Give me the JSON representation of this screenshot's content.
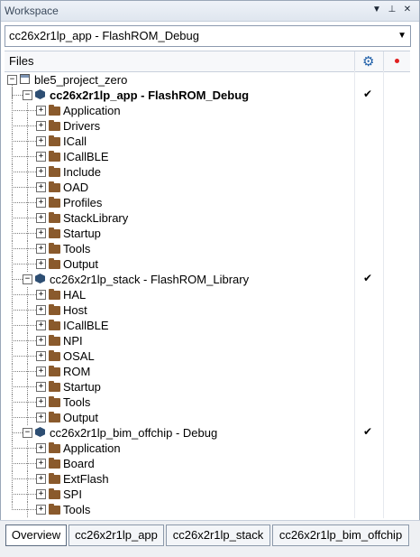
{
  "panel": {
    "title": "Workspace",
    "controls": [
      "▼",
      "⊥",
      "✕"
    ]
  },
  "config": {
    "selected": "cc26x2r1lp_app - FlashROM_Debug"
  },
  "header": {
    "files_label": "Files"
  },
  "tree": [
    {
      "label": "ble5_project_zero",
      "level": 0,
      "type": "workspace",
      "expander": "⊟",
      "check": ""
    },
    {
      "label": "cc26x2r1lp_app - FlashROM_Debug",
      "level": 1,
      "type": "project",
      "expander": "⊟",
      "bold": true,
      "check": "✔"
    },
    {
      "label": "Application",
      "level": 2,
      "type": "folder",
      "expander": "⊞",
      "check": ""
    },
    {
      "label": "Drivers",
      "level": 2,
      "type": "folder",
      "expander": "⊞",
      "check": ""
    },
    {
      "label": "ICall",
      "level": 2,
      "type": "folder",
      "expander": "⊞",
      "check": ""
    },
    {
      "label": "ICallBLE",
      "level": 2,
      "type": "folder",
      "expander": "⊞",
      "check": ""
    },
    {
      "label": "Include",
      "level": 2,
      "type": "folder",
      "expander": "⊞",
      "check": ""
    },
    {
      "label": "OAD",
      "level": 2,
      "type": "folder",
      "expander": "⊞",
      "check": ""
    },
    {
      "label": "Profiles",
      "level": 2,
      "type": "folder",
      "expander": "⊞",
      "check": ""
    },
    {
      "label": "StackLibrary",
      "level": 2,
      "type": "folder",
      "expander": "⊞",
      "check": ""
    },
    {
      "label": "Startup",
      "level": 2,
      "type": "folder",
      "expander": "⊞",
      "check": ""
    },
    {
      "label": "Tools",
      "level": 2,
      "type": "folder",
      "expander": "⊞",
      "check": ""
    },
    {
      "label": "Output",
      "level": 2,
      "type": "folder",
      "expander": "⊞",
      "check": ""
    },
    {
      "label": "cc26x2r1lp_stack - FlashROM_Library",
      "level": 1,
      "type": "project",
      "expander": "⊟",
      "check": "✔"
    },
    {
      "label": "HAL",
      "level": 2,
      "type": "folder",
      "expander": "⊞",
      "check": ""
    },
    {
      "label": "Host",
      "level": 2,
      "type": "folder",
      "expander": "⊞",
      "check": ""
    },
    {
      "label": "ICallBLE",
      "level": 2,
      "type": "folder",
      "expander": "⊞",
      "check": ""
    },
    {
      "label": "NPI",
      "level": 2,
      "type": "folder",
      "expander": "⊞",
      "check": ""
    },
    {
      "label": "OSAL",
      "level": 2,
      "type": "folder",
      "expander": "⊞",
      "check": ""
    },
    {
      "label": "ROM",
      "level": 2,
      "type": "folder",
      "expander": "⊞",
      "check": ""
    },
    {
      "label": "Startup",
      "level": 2,
      "type": "folder",
      "expander": "⊞",
      "check": ""
    },
    {
      "label": "Tools",
      "level": 2,
      "type": "folder",
      "expander": "⊞",
      "check": ""
    },
    {
      "label": "Output",
      "level": 2,
      "type": "folder",
      "expander": "⊞",
      "check": ""
    },
    {
      "label": "cc26x2r1lp_bim_offchip - Debug",
      "level": 1,
      "type": "project",
      "expander": "⊟",
      "check": "✔"
    },
    {
      "label": "Application",
      "level": 2,
      "type": "folder",
      "expander": "⊞",
      "check": ""
    },
    {
      "label": "Board",
      "level": 2,
      "type": "folder",
      "expander": "⊞",
      "check": ""
    },
    {
      "label": "ExtFlash",
      "level": 2,
      "type": "folder",
      "expander": "⊞",
      "check": ""
    },
    {
      "label": "SPI",
      "level": 2,
      "type": "folder",
      "expander": "⊞",
      "check": ""
    },
    {
      "label": "Tools",
      "level": 2,
      "type": "folder",
      "expander": "⊞",
      "check": ""
    }
  ],
  "tabs": [
    "Overview",
    "cc26x2r1lp_app",
    "cc26x2r1lp_stack",
    "cc26x2r1lp_bim_offchip"
  ],
  "active_tab": 0,
  "colors": {
    "folder": "#8a5a2c",
    "project_cube": "#2d4e73",
    "debug_dot": "#e02020",
    "gear": "#1f5fa8"
  },
  "icons": {
    "settings": "gear-icon",
    "breakpoint": "red-dot-icon",
    "dropdown": "chevron-down-icon"
  }
}
